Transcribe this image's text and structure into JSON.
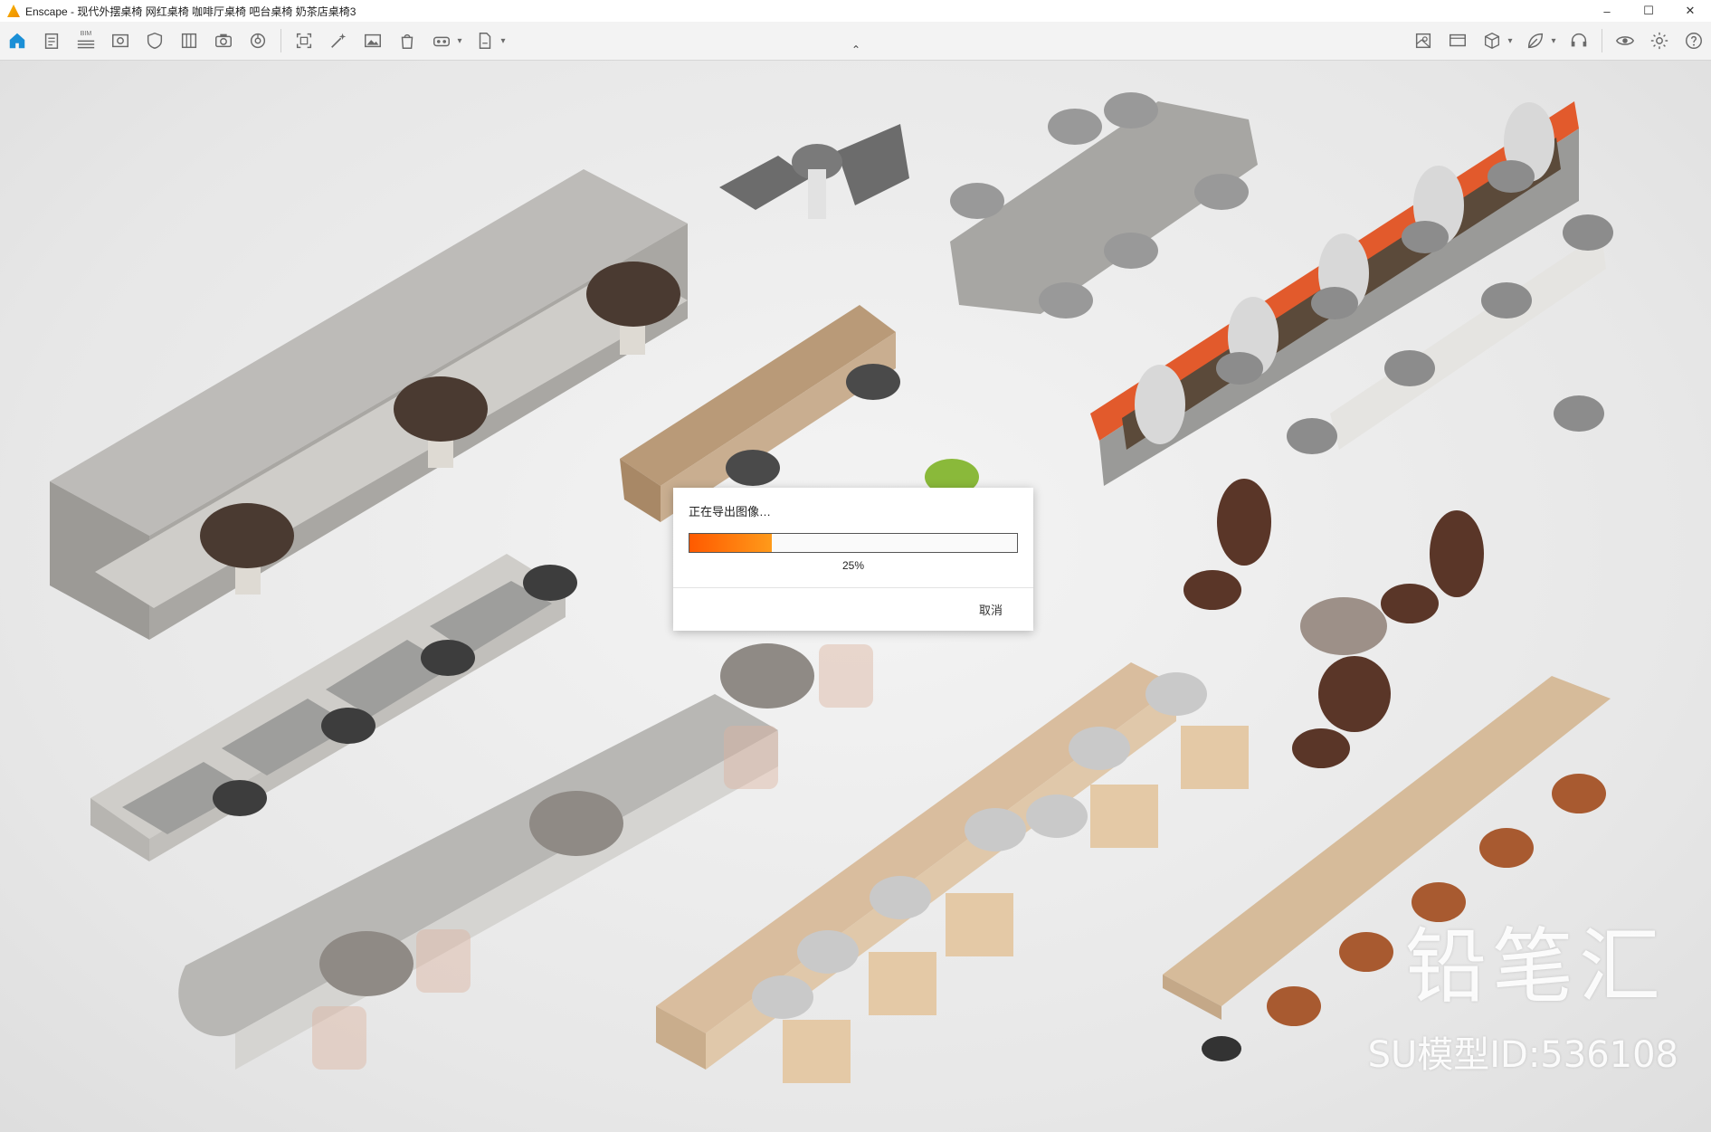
{
  "window": {
    "title": "Enscape - 现代外摆桌椅 网红桌椅 咖啡厅桌椅 吧台桌椅 奶茶店桌椅3",
    "controls": {
      "minimize": "–",
      "maximize": "☐",
      "close": "✕"
    }
  },
  "toolbar": {
    "left_icons": [
      "home-icon",
      "document-icon",
      "bim-icon",
      "view-icon",
      "shield-icon",
      "library-icon",
      "camera-icon",
      "asset-icon",
      "capture-icon",
      "magic-icon",
      "image-icon",
      "bag-icon",
      "vr-icon",
      "export-icon"
    ],
    "bim_label": "BIM",
    "right_icons": [
      "map-icon",
      "screen-icon",
      "cube-icon",
      "leaf-icon",
      "headset-icon",
      "eye-icon",
      "settings-icon",
      "help-icon"
    ],
    "collapse_glyph": "⌃"
  },
  "dialog": {
    "title": "正在导出图像…",
    "progress": 0.25,
    "progress_label": "25%",
    "cancel_label": "取消"
  },
  "watermark": {
    "brand": "铅笔汇",
    "model_id": "SU模型ID:536108"
  },
  "colors": {
    "accent_home": "#1a8fd6",
    "progress_start": "#ff5a00",
    "progress_end": "#ff9a1a"
  }
}
